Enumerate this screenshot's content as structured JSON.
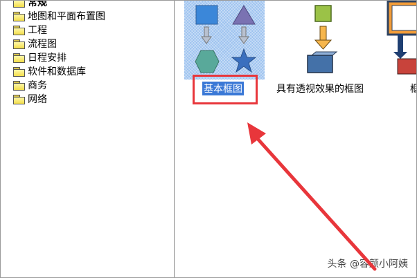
{
  "sidebar": {
    "items": [
      {
        "label": "常规"
      },
      {
        "label": "地图和平面布置图"
      },
      {
        "label": "工程"
      },
      {
        "label": "流程图"
      },
      {
        "label": "日程安排"
      },
      {
        "label": "软件和数据库"
      },
      {
        "label": "商务"
      },
      {
        "label": "网络"
      }
    ]
  },
  "templates": {
    "items": [
      {
        "label": "基本框图",
        "selected": true
      },
      {
        "label": "具有透视效果的框图",
        "selected": false
      },
      {
        "label": "框",
        "selected": false
      }
    ]
  },
  "colors": {
    "highlight": "#e8363b",
    "selection": "#3a78d6",
    "arrow": "#e8363b"
  },
  "watermark": {
    "text": "头条 @容颜小阿姨"
  }
}
